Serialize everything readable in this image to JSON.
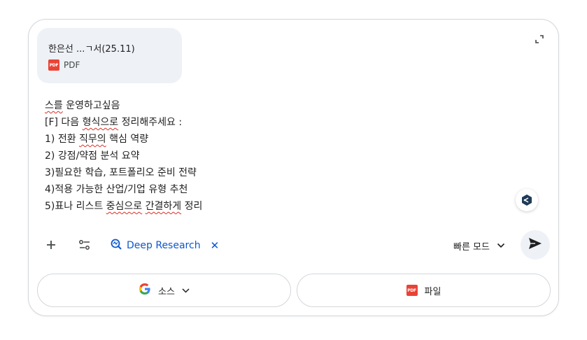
{
  "attachment": {
    "name": "한은선 ...ㄱ서(25.11)",
    "type_label": "PDF",
    "badge_text": "PDF"
  },
  "prompt_lines": [
    "스를 운영하고싶음",
    "[F] 다음 형식으로 정리해주세요 :",
    "1) 전환 직무의 핵심 역량",
    "2) 강점/약점 분석 요약",
    "3)필요한 학습, 포트폴리오 준비 전략",
    "4)적용 가능한 산업/기업 유형 추천",
    "5)표나 리스트 중심으로 간결하게 정리"
  ],
  "toolbar": {
    "tool_chip_label": "Deep Research",
    "mode_label": "빠른 모드"
  },
  "bottom": {
    "source_label": "소스",
    "file_label": "파일",
    "file_badge_text": "PDF"
  },
  "colors": {
    "accent": "#0b57d0",
    "pdf_red": "#ea4335",
    "surface": "#eef1f6",
    "border": "#d3d6da"
  },
  "icons": [
    "expand-icon",
    "add-icon",
    "tune-icon",
    "deep-research-icon",
    "close-icon",
    "chevron-down-icon",
    "send-icon",
    "google-icon",
    "pdf-icon",
    "assistant-icon"
  ]
}
